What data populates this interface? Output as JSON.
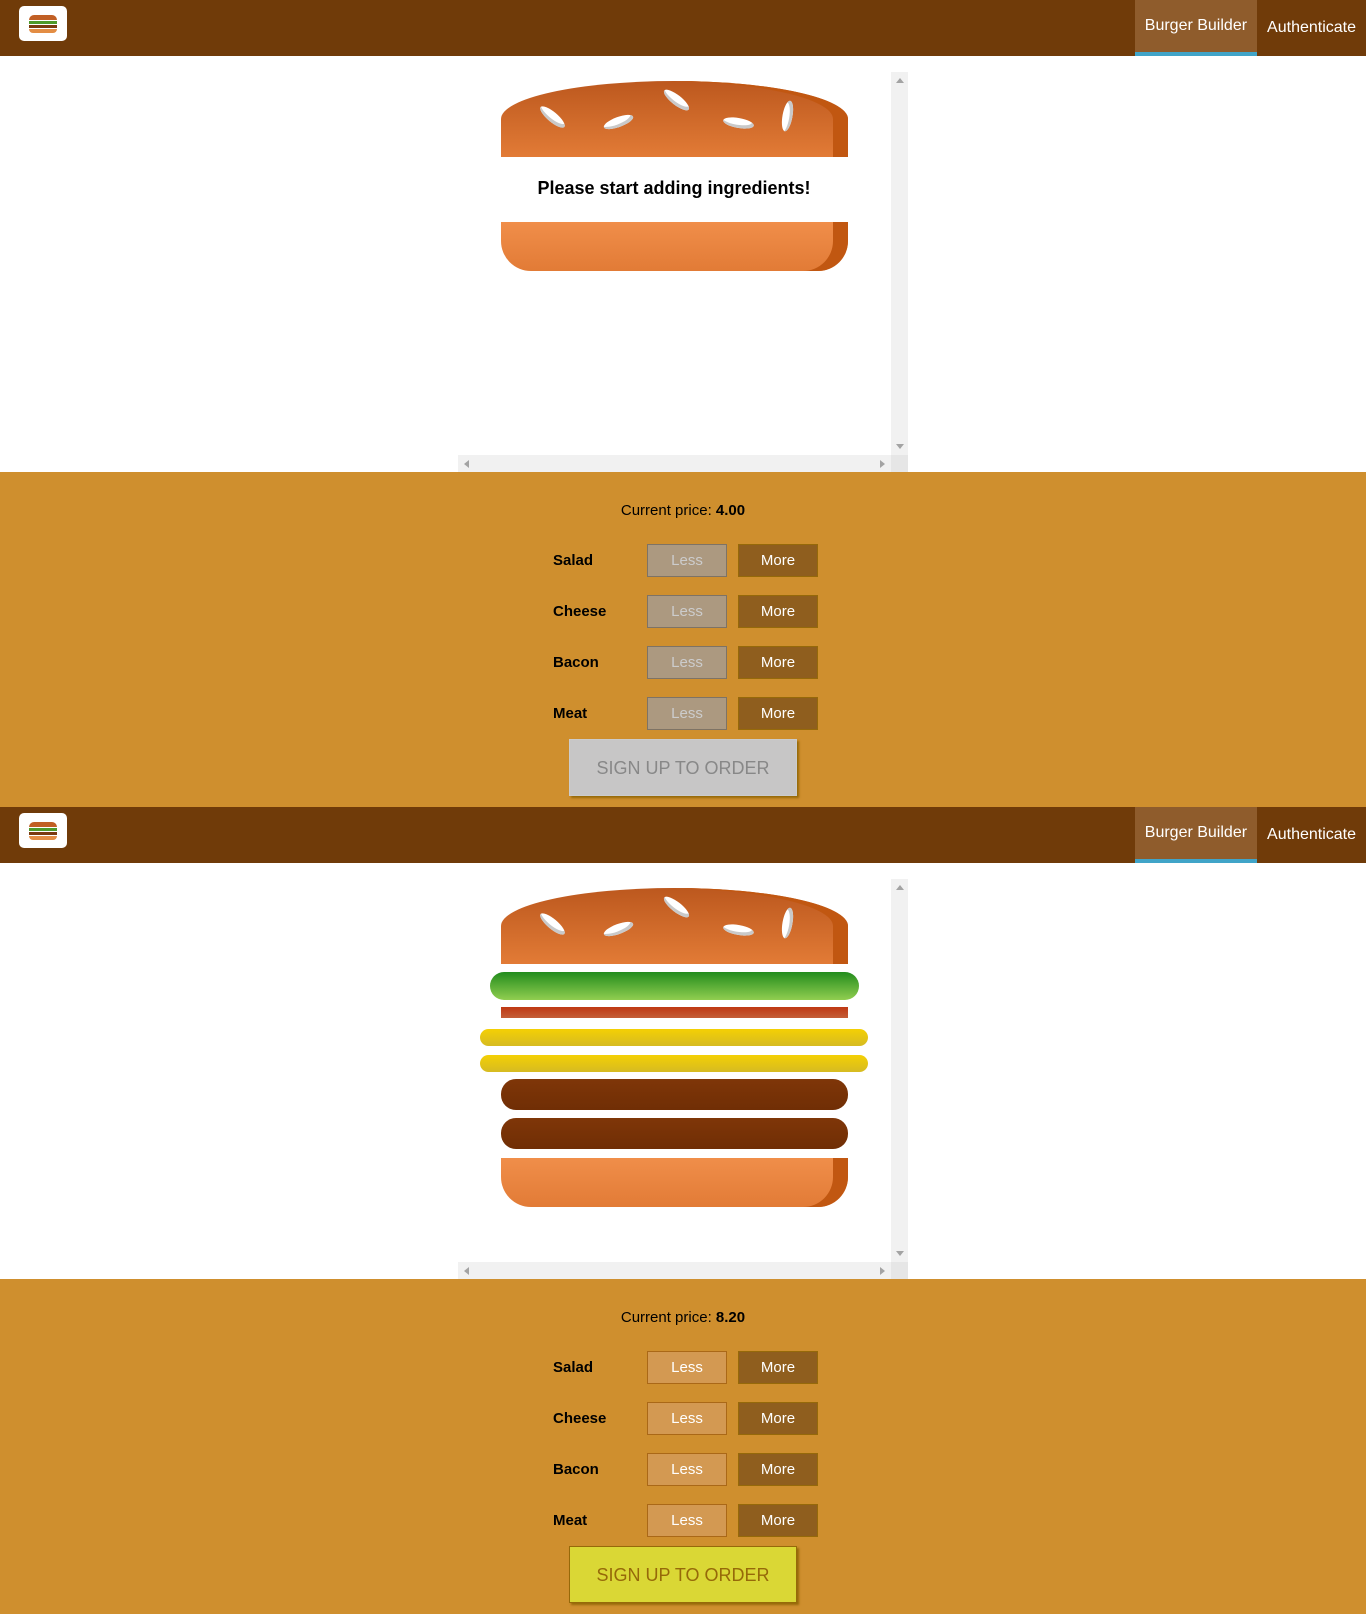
{
  "states": [
    {
      "nav": {
        "items": [
          {
            "label": "Burger Builder",
            "active": true
          },
          {
            "label": "Authenticate",
            "active": false
          }
        ]
      },
      "burger": {
        "message": "Please start adding ingredients!",
        "ingredients": []
      },
      "controls": {
        "price_label": "Current price:",
        "price_value": "4.00",
        "rows": [
          {
            "label": "Salad",
            "less": "Less",
            "more": "More",
            "less_disabled": true
          },
          {
            "label": "Cheese",
            "less": "Less",
            "more": "More",
            "less_disabled": true
          },
          {
            "label": "Bacon",
            "less": "Less",
            "more": "More",
            "less_disabled": true
          },
          {
            "label": "Meat",
            "less": "Less",
            "more": "More",
            "less_disabled": true
          }
        ],
        "order_button": "SIGN UP TO ORDER",
        "order_disabled": true
      }
    },
    {
      "nav": {
        "items": [
          {
            "label": "Burger Builder",
            "active": true
          },
          {
            "label": "Authenticate",
            "active": false
          }
        ]
      },
      "burger": {
        "message": "",
        "ingredients": [
          "salad",
          "bacon",
          "cheese",
          "cheese",
          "meat",
          "meat"
        ]
      },
      "controls": {
        "price_label": "Current price:",
        "price_value": "8.20",
        "rows": [
          {
            "label": "Salad",
            "less": "Less",
            "more": "More",
            "less_disabled": false
          },
          {
            "label": "Cheese",
            "less": "Less",
            "more": "More",
            "less_disabled": false
          },
          {
            "label": "Bacon",
            "less": "Less",
            "more": "More",
            "less_disabled": false
          },
          {
            "label": "Meat",
            "less": "Less",
            "more": "More",
            "less_disabled": false
          }
        ],
        "order_button": "SIGN UP TO ORDER",
        "order_disabled": false
      }
    }
  ]
}
